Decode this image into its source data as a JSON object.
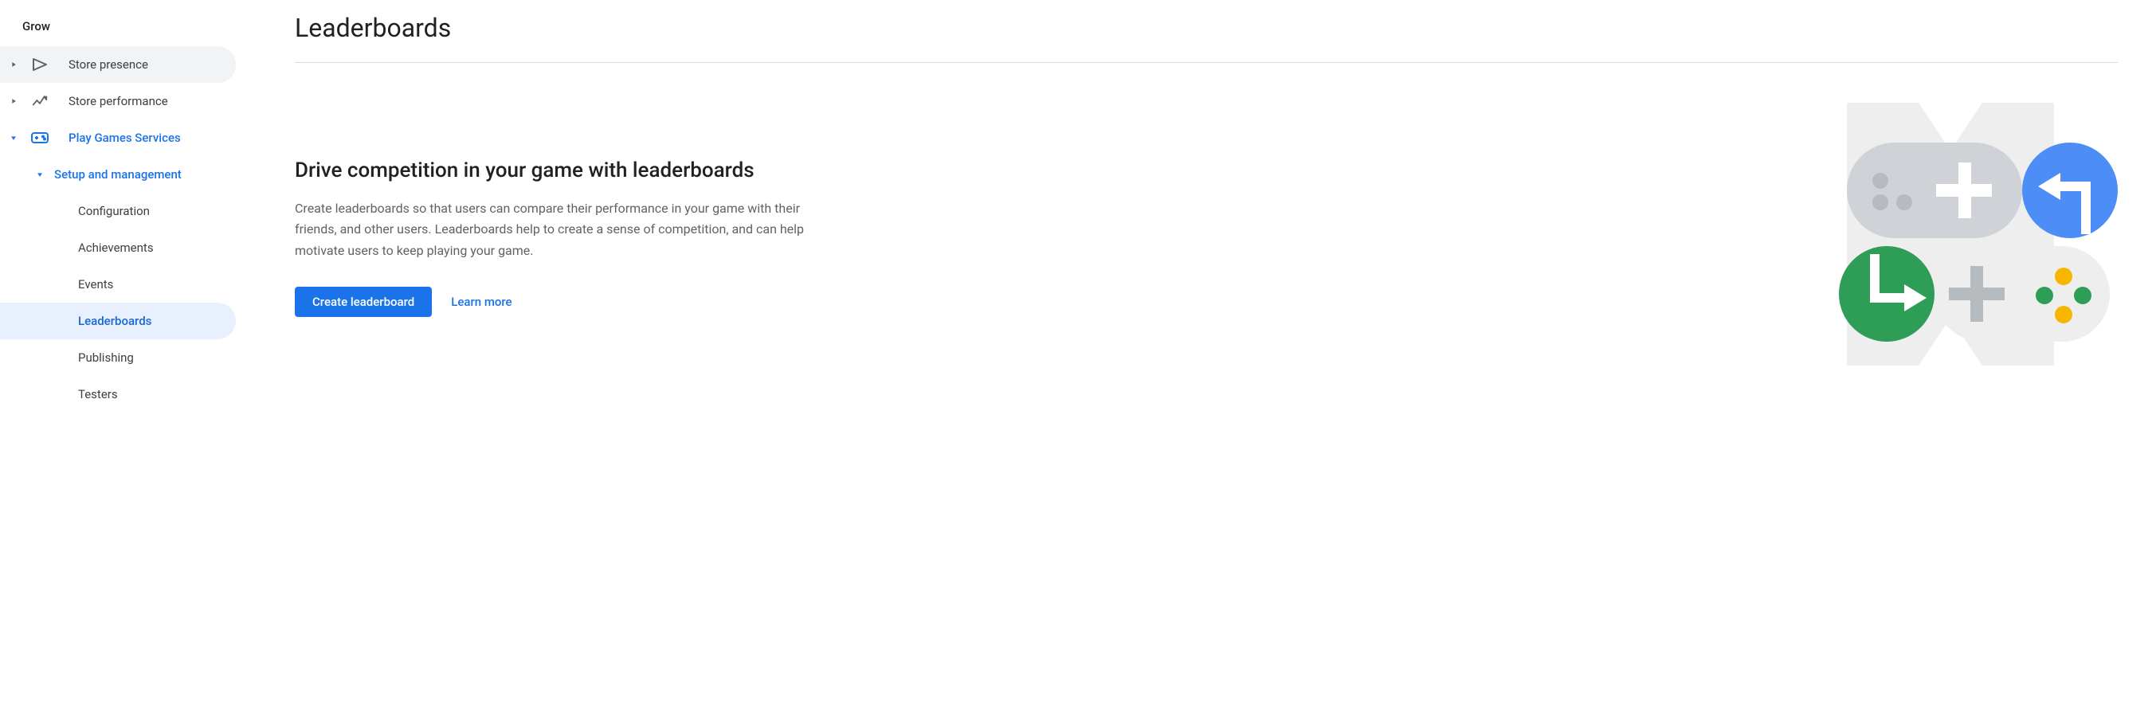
{
  "sidebar": {
    "header": "Grow",
    "items": [
      {
        "label": "Store presence"
      },
      {
        "label": "Store performance"
      },
      {
        "label": "Play Games Services"
      },
      {
        "label": "Setup and management"
      },
      {
        "label": "Configuration"
      },
      {
        "label": "Achievements"
      },
      {
        "label": "Events"
      },
      {
        "label": "Leaderboards"
      },
      {
        "label": "Publishing"
      },
      {
        "label": "Testers"
      }
    ]
  },
  "main": {
    "title": "Leaderboards",
    "heading": "Drive competition in your game with leaderboards",
    "body": "Create leaderboards so that users can compare their performance in your game with their friends, and other users. Leaderboards help to create a sense of competition, and can help motivate users to keep playing your game.",
    "create_button": "Create leaderboard",
    "learn_more": "Learn more"
  }
}
